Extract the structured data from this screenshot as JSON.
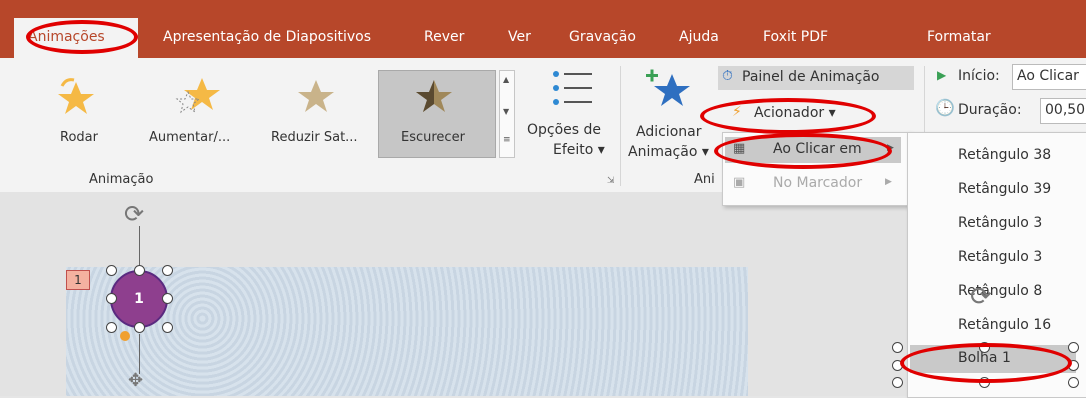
{
  "tabs": [
    {
      "label": "Animações"
    },
    {
      "label": "Apresentação de Diapositivos"
    },
    {
      "label": "Rever"
    },
    {
      "label": "Ver"
    },
    {
      "label": "Gravação"
    },
    {
      "label": "Ajuda"
    },
    {
      "label": "Foxit PDF"
    },
    {
      "label": "Formatar"
    }
  ],
  "animation_group": {
    "items": [
      {
        "label": "Rodar"
      },
      {
        "label": "Aumentar/..."
      },
      {
        "label": "Reduzir Sat..."
      },
      {
        "label": "Escurecer"
      }
    ],
    "group_label": "Animação",
    "effect_options": {
      "line1": "Opções de",
      "line2": "Efeito ▾"
    }
  },
  "advanced_group": {
    "add_animation": {
      "line1": "Adicionar",
      "line2": "Animação ▾"
    },
    "group_label": "Ani",
    "animation_pane": "Painel de Animação",
    "trigger": "Acionador ▾"
  },
  "timing_group": {
    "start_label": "Início:",
    "start_value": "Ao Clicar",
    "duration_label": "Duração:",
    "duration_value": "00,50"
  },
  "trigger_menu": {
    "on_click": "Ao Clicar em",
    "on_bookmark": "No Marcador"
  },
  "shapes_submenu": [
    "Retângulo 38",
    "Retângulo 39",
    "Retângulo 3",
    "Retângulo 3",
    "Retângulo 8",
    "Retângulo 16",
    "Bolha 1"
  ],
  "slide": {
    "animation_badge": "1",
    "bubble_label": "1"
  },
  "colors": {
    "accent": "#b7472a",
    "highlight": "#e00000",
    "bubble": "#8e3f8e"
  }
}
